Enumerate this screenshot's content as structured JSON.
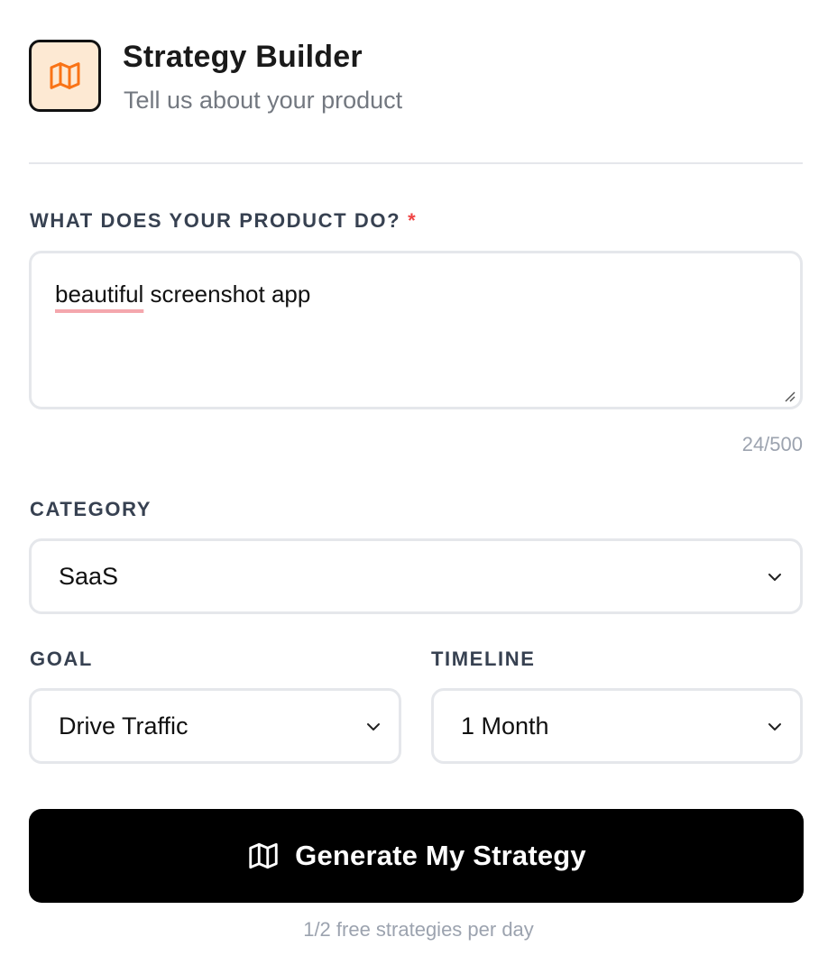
{
  "header": {
    "title": "Strategy Builder",
    "subtitle": "Tell us about your product",
    "icon": "map-icon",
    "accent_color": "#f97316"
  },
  "product": {
    "label": "WHAT DOES YOUR PRODUCT DO?",
    "required_mark": "*",
    "value_misspelled": "beautiful",
    "value_rest": " screenshot app",
    "char_count": "24/500"
  },
  "category": {
    "label": "CATEGORY",
    "selected": "SaaS"
  },
  "goal": {
    "label": "GOAL",
    "selected": "Drive Traffic"
  },
  "timeline": {
    "label": "TIMELINE",
    "selected": "1 Month"
  },
  "submit": {
    "label": "Generate My Strategy",
    "icon": "map-icon"
  },
  "footnote": "1/2 free strategies per day"
}
